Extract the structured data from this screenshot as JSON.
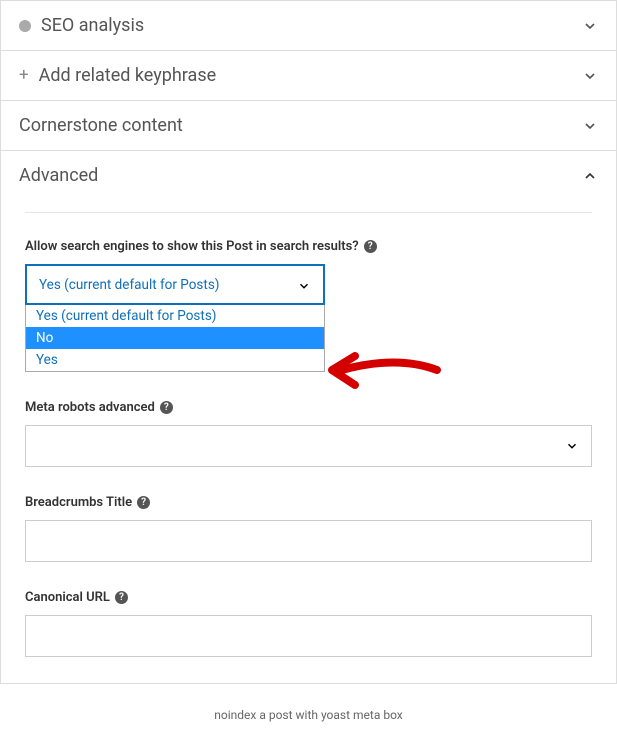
{
  "sections": {
    "seo_analysis": {
      "label": "SEO analysis"
    },
    "add_keyphrase": {
      "label": "Add related keyphrase"
    },
    "cornerstone": {
      "label": "Cornerstone content"
    },
    "advanced": {
      "label": "Advanced"
    }
  },
  "advanced": {
    "allow_search": {
      "label": "Allow search engines to show this Post in search results?",
      "selected": "Yes (current default for Posts)",
      "options": [
        "Yes (current default for Posts)",
        "No",
        "Yes"
      ],
      "highlighted_index": 1
    },
    "meta_robots": {
      "label": "Meta robots advanced",
      "value": ""
    },
    "breadcrumbs": {
      "label": "Breadcrumbs Title",
      "value": ""
    },
    "canonical": {
      "label": "Canonical URL",
      "value": ""
    }
  },
  "caption": "noindex a post with yoast meta box"
}
